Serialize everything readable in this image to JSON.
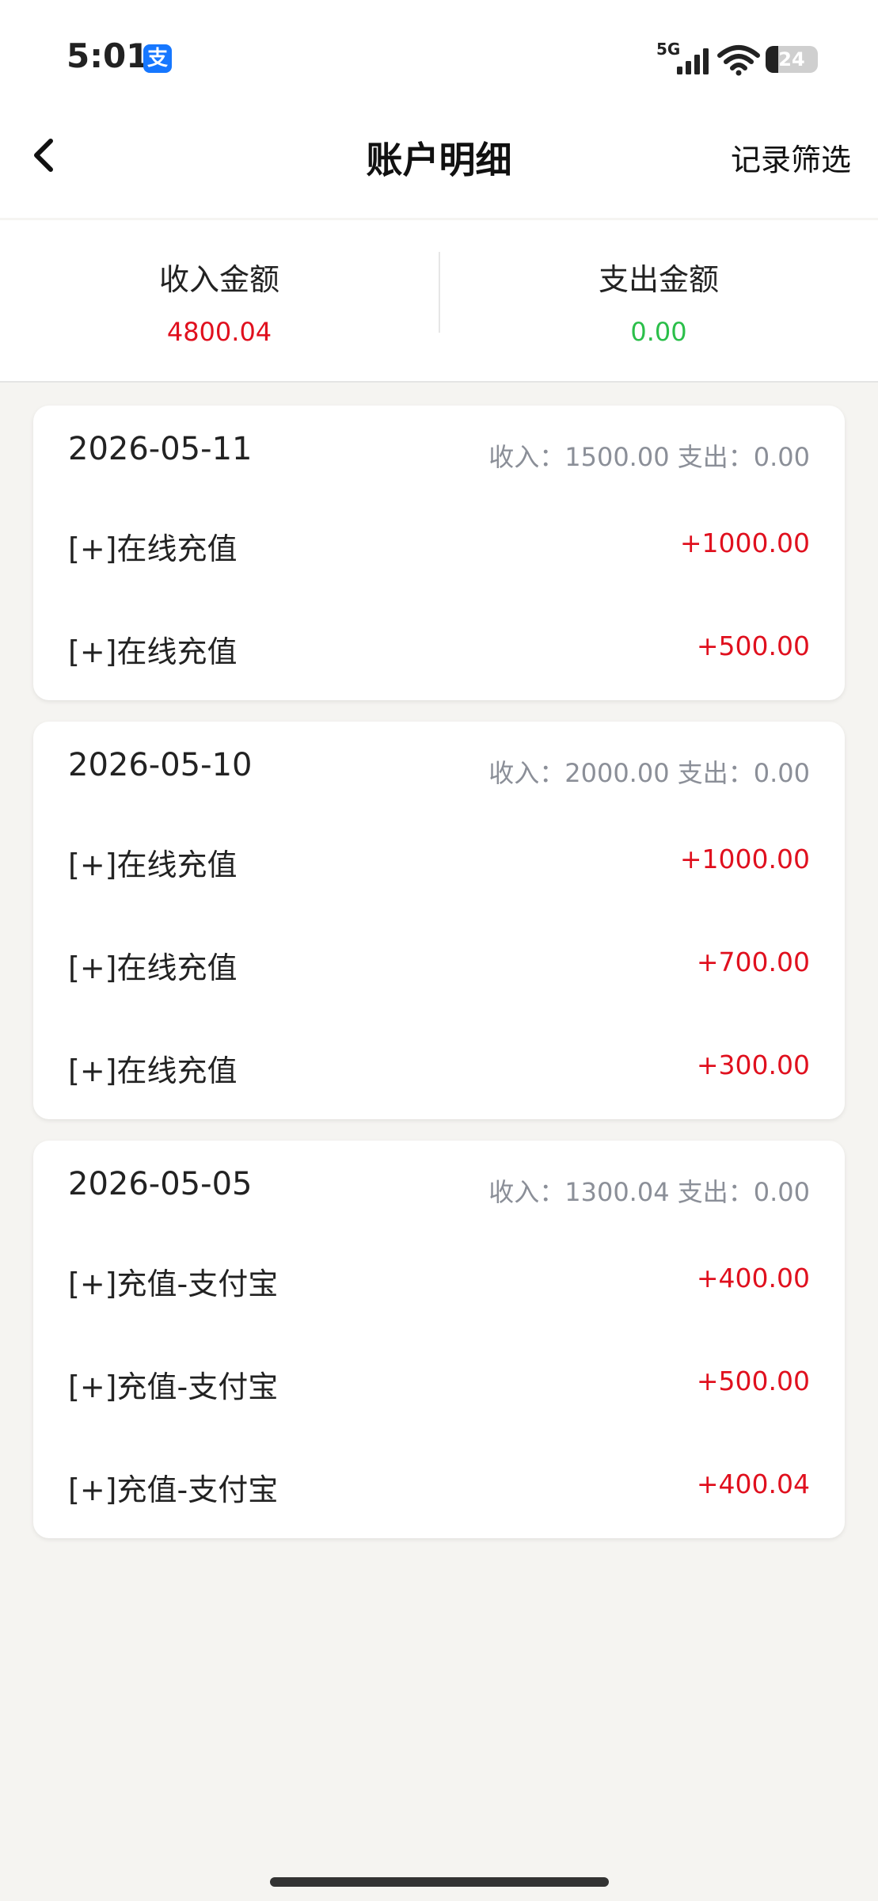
{
  "status_bar": {
    "time": "5:01",
    "alipay_badge": "支",
    "network": "5G",
    "battery": "24"
  },
  "nav": {
    "title": "账户明细",
    "filter_label": "记录筛选"
  },
  "summary": {
    "income_label": "收入金额",
    "income_value": "4800.04",
    "expense_label": "支出金额",
    "expense_value": "0.00"
  },
  "groups": [
    {
      "date": "2026-05-11",
      "summary": "收入：1500.00 支出：0.00",
      "rows": [
        {
          "label": "[+]在线充值",
          "amount": "+1000.00"
        },
        {
          "label": "[+]在线充值",
          "amount": "+500.00"
        }
      ]
    },
    {
      "date": "2026-05-10",
      "summary": "收入：2000.00 支出：0.00",
      "rows": [
        {
          "label": "[+]在线充值",
          "amount": "+1000.00"
        },
        {
          "label": "[+]在线充值",
          "amount": "+700.00"
        },
        {
          "label": "[+]在线充值",
          "amount": "+300.00"
        }
      ]
    },
    {
      "date": "2026-05-05",
      "summary": "收入：1300.04 支出：0.00",
      "rows": [
        {
          "label": "[+]充值-支付宝",
          "amount": "+400.00"
        },
        {
          "label": "[+]充值-支付宝",
          "amount": "+500.00"
        },
        {
          "label": "[+]充值-支付宝",
          "amount": "+400.04"
        }
      ]
    }
  ],
  "colors": {
    "income": "#e0101e",
    "expense": "#2bbf4a",
    "muted": "#8b8f98",
    "background": "#f5f4f1"
  }
}
